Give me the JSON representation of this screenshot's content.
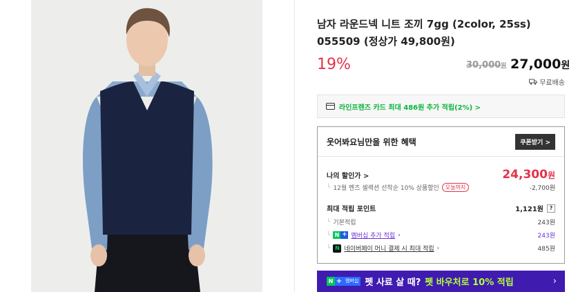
{
  "product": {
    "title": "남자 라운드넥 니트 조끼 7gg (2color, 25ss) 055509 (정상가 49,800원)",
    "discount_rate": "19%",
    "original_price": "30,000",
    "original_unit": "원",
    "sale_price": "27,000",
    "sale_unit": "원",
    "shipping": "무료배송"
  },
  "card_promo": {
    "text": "라인프렌즈 카드 최대 486원 추가 적립(2%) >"
  },
  "benefit": {
    "title": "웃어봐요님만을 위한 혜택",
    "coupon_button": "쿠폰받기 >",
    "my_price_label": "나의 할인가 >",
    "my_price": "24,300",
    "my_price_unit": "원",
    "discount_detail": "12월 멘즈 셀렉션 선착순 10% 상품할인",
    "today_badge": "오늘까지",
    "discount_amount": "-2,700원",
    "points_label": "최대 적립 포인트",
    "points_total": "1,121원",
    "points_help": "?",
    "basic_label": "기본적립",
    "basic_value": "243원",
    "membership_label": "멤버십 추가 적립",
    "membership_value": "243원",
    "npay_label": "네이버페이 머니 결제 시 최대 적립",
    "npay_value": "485원"
  },
  "banner": {
    "badge_n": "N",
    "badge_plus": "+",
    "badge_member": "멤버십",
    "text": "펫 사료 살 때?",
    "highlight": "펫 바우처로 10% 적립",
    "arrow": "›"
  },
  "colors": {
    "accent_red": "#e3324a",
    "naver_green": "#03c75a",
    "banner_purple": "#3f1bb0",
    "membership_purple": "#6b2fd6"
  }
}
